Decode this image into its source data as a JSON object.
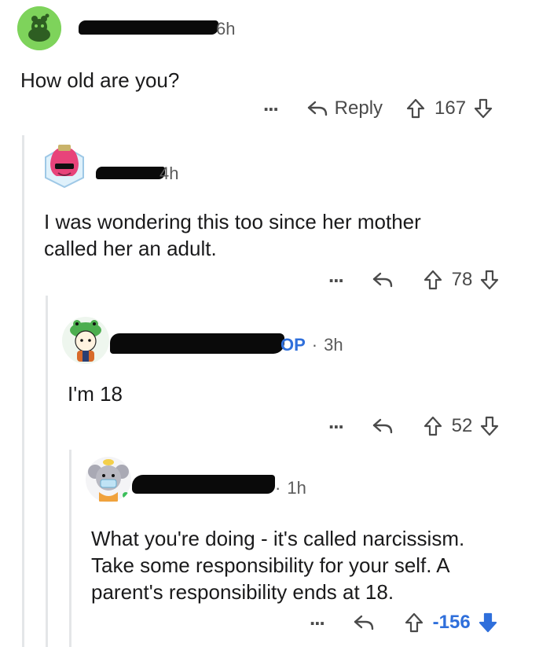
{
  "comments": [
    {
      "age": "6h",
      "text": "How old are you?",
      "reply_label": "Reply",
      "score": "167",
      "avatar": "snoo-avatar-green"
    },
    {
      "age": "4h",
      "text": "I was wondering this too since her mother\ncalled her an adult.",
      "score": "78",
      "avatar": "pink-hair-sunglasses-avatar"
    },
    {
      "op_badge": "OP",
      "sep": "·",
      "age": "3h",
      "text": "I'm 18",
      "score": "52",
      "avatar": "frog-hat-avatar"
    },
    {
      "sep": "·",
      "age": "1h",
      "text": "What you're doing - it's called narcissism.\nTake some responsibility for your self. A\nparent's responsibility ends at 18.",
      "score": "-156",
      "avatar": "koala-mask-avatar"
    }
  ],
  "more_label": "...",
  "colors": {
    "downvote_active": "#2f6fdb",
    "op": "#2f6fdb",
    "thread_line": "#e4e6e8"
  }
}
